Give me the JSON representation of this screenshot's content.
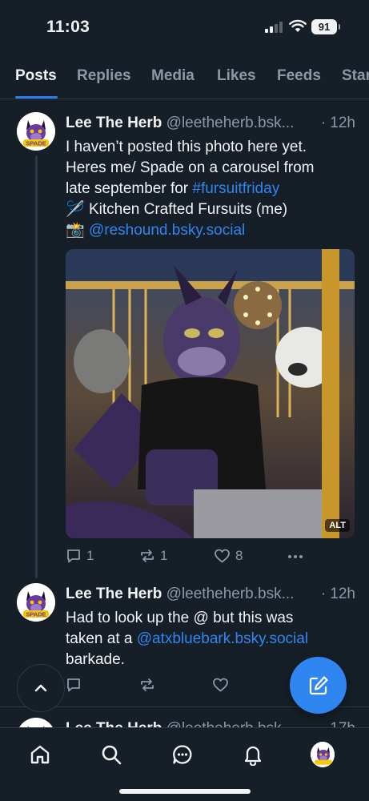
{
  "status_bar": {
    "time": "11:03",
    "battery": "91"
  },
  "tabs": [
    {
      "label": "Posts",
      "active": true
    },
    {
      "label": "Replies",
      "active": false
    },
    {
      "label": "Media",
      "active": false
    },
    {
      "label": "Likes",
      "active": false
    },
    {
      "label": "Feeds",
      "active": false
    },
    {
      "label": "Star",
      "active": false
    }
  ],
  "posts": [
    {
      "author_name": "Lee The Herb",
      "author_handle": "@leetheherb.bsk...",
      "time": "· 12h",
      "text_line1": "I haven’t posted this photo here yet.",
      "text_line2": "Heres me/ Spade on a carousel from",
      "text_line3_prefix": "late september for ",
      "text_line3_link": "#fursuitfriday",
      "text_line4_emoji": "🪡",
      "text_line4": " Kitchen Crafted Fursuits (me)",
      "text_line5_emoji": "📸",
      "text_line5_link": "@reshound.bsky.social",
      "image_alt_badge": "ALT",
      "reply_count": "1",
      "repost_count": "1",
      "like_count": "8"
    },
    {
      "author_name": "Lee The Herb",
      "author_handle": "@leetheherb.bsk...",
      "time": "· 12h",
      "text_line1": "Had to look up the @ but this was",
      "text_line2_prefix": "taken at a ",
      "text_line2_link": "@atxbluebark.bsky.social",
      "text_line3": "barkade."
    },
    {
      "author_name": "Lee The Herb",
      "author_handle": "@leetheherb.bsk...",
      "time": "· 17h"
    }
  ],
  "avatar_text": "SPADE",
  "colors": {
    "background": "#161e27",
    "accent": "#2f86f0",
    "muted": "#8b98a5",
    "divider": "#2c3845"
  },
  "icons": [
    "signal-icon",
    "wifi-icon",
    "reply-icon",
    "repost-icon",
    "like-icon",
    "more-icon",
    "chevron-up-icon",
    "compose-icon",
    "home-icon",
    "search-icon",
    "chat-icon",
    "bell-icon"
  ]
}
